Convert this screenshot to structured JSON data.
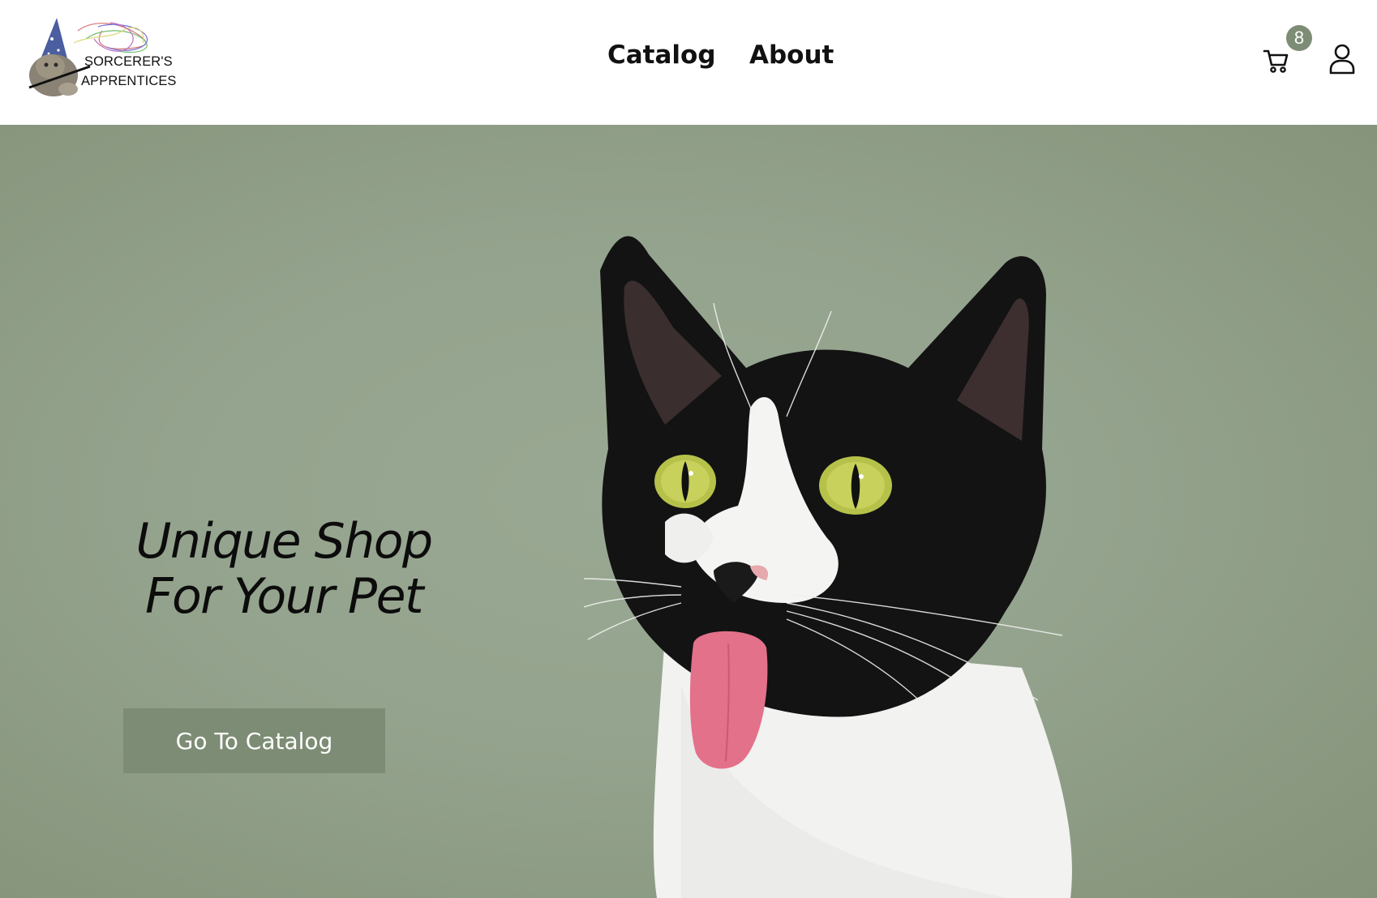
{
  "header": {
    "logo": {
      "line1": "SORCERER'S",
      "line2": "APPRENTICES"
    },
    "nav": {
      "catalog_label": "Catalog",
      "about_label": "About"
    },
    "cart": {
      "icon": "cart-icon",
      "count": "8"
    },
    "account": {
      "icon": "user-icon"
    }
  },
  "hero": {
    "headline_line1": "Unique Shop",
    "headline_line2": "For Your Pet",
    "cta_label": "Go To Catalog",
    "image": "black-and-white-cat-with-tongue-out"
  },
  "colors": {
    "accent": "#7d8c74",
    "hero_background": "#94a38d",
    "header_background": "#ffffff",
    "text": "#111111"
  }
}
